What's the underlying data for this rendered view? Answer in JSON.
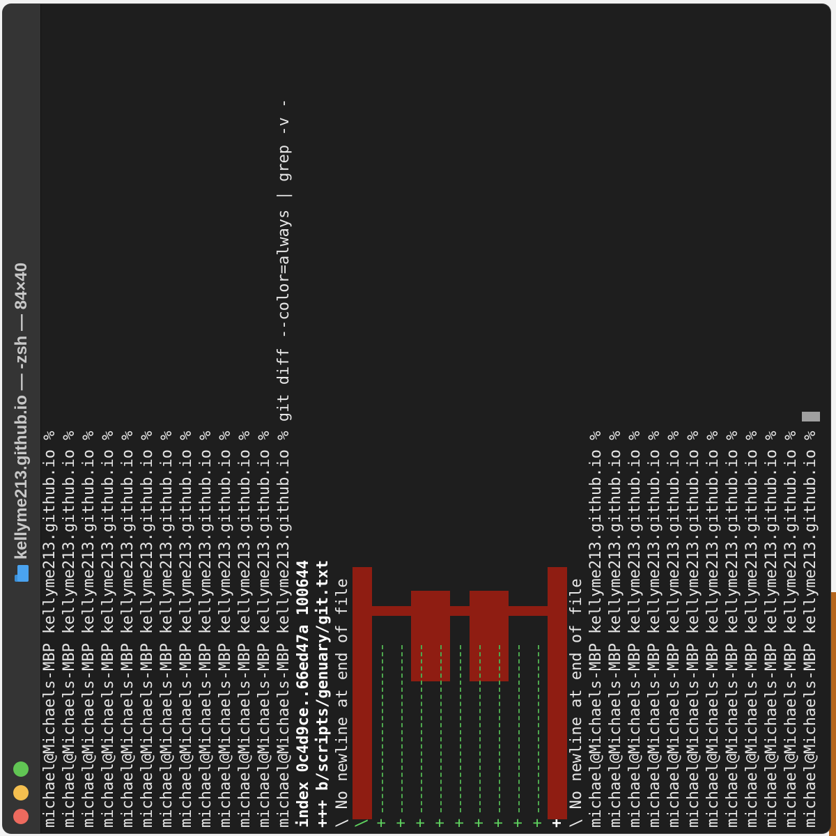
{
  "window": {
    "title": "kellyme213.github.io — -zsh — 84×40",
    "icon": "folder-icon"
  },
  "colors": {
    "background": "#1e1e1e",
    "text": "#e6e6e6",
    "diff_added": "#5fd35f",
    "art_red": "#8f1d12",
    "close": "#ed6a5e",
    "minimize": "#f4bf4f",
    "zoom": "#61c554"
  },
  "terminal": {
    "prompt": "michael@Michaels-MBP kellyme213.github.io %",
    "prompts_before": 12,
    "command": "git diff --color=always | grep -v -",
    "diff_index": "index 0c4d9ce..66ed47a 100644",
    "diff_file": "+++ b/scripts/genuary/git.txt",
    "no_newline": "\\ No newline at end of file",
    "plus_marker": "+",
    "backslash": "\\",
    "no_newline_after": "No newline at end of file",
    "prompts_after": 12
  }
}
